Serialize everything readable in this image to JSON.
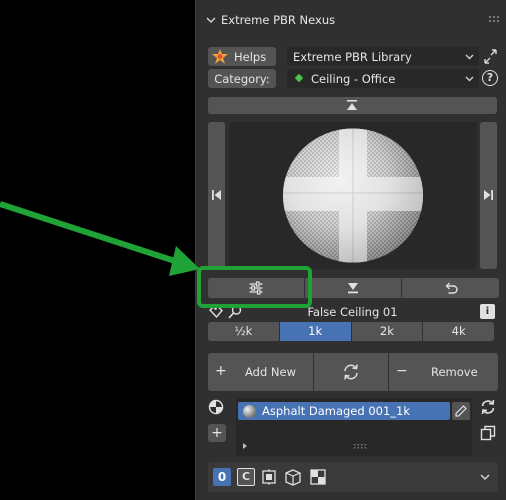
{
  "panel": {
    "title": "Extreme PBR Nexus"
  },
  "library": {
    "helps_label": "Helps",
    "library_value": "Extreme PBR Library",
    "category_label": "Category:",
    "category_value": "Ceiling - Office",
    "help_glyph": "?"
  },
  "preview": {
    "material_name": "False Ceiling 01",
    "info_glyph": "i"
  },
  "resolutions": {
    "options": [
      "½k",
      "1k",
      "2k",
      "4k"
    ],
    "selected": "1k"
  },
  "actions": {
    "add_label": "Add New",
    "remove_label": "Remove",
    "add_symbol": "+",
    "remove_symbol": "−"
  },
  "material_list": {
    "items": [
      {
        "label": "Asphalt Damaged 001_1k"
      }
    ]
  },
  "bottom_bar": {
    "zero_label": "0",
    "c_label": "C",
    "plus_symbol": "+"
  },
  "colors": {
    "accent": "#4772b3",
    "annotation": "#1fa236",
    "panel_bg": "#303030",
    "button_bg": "#545454",
    "field_bg": "#282828"
  },
  "icons": [
    "chevron-down-icon",
    "grip-icon",
    "helps-star-icon",
    "external-link-icon",
    "category-diamond-icon",
    "help-icon",
    "move-to-top-icon",
    "skip-previous-icon",
    "skip-next-icon",
    "sliders-icon",
    "move-to-bottom-icon",
    "undo-icon",
    "tag-icon",
    "magnifier-icon",
    "info-icon",
    "refresh-icon",
    "material-ball-icon",
    "edit-icon",
    "expand-icon",
    "sphere-icon",
    "add-icon",
    "copy-icon",
    "cube-icon",
    "box-icon",
    "checker-icon"
  ]
}
